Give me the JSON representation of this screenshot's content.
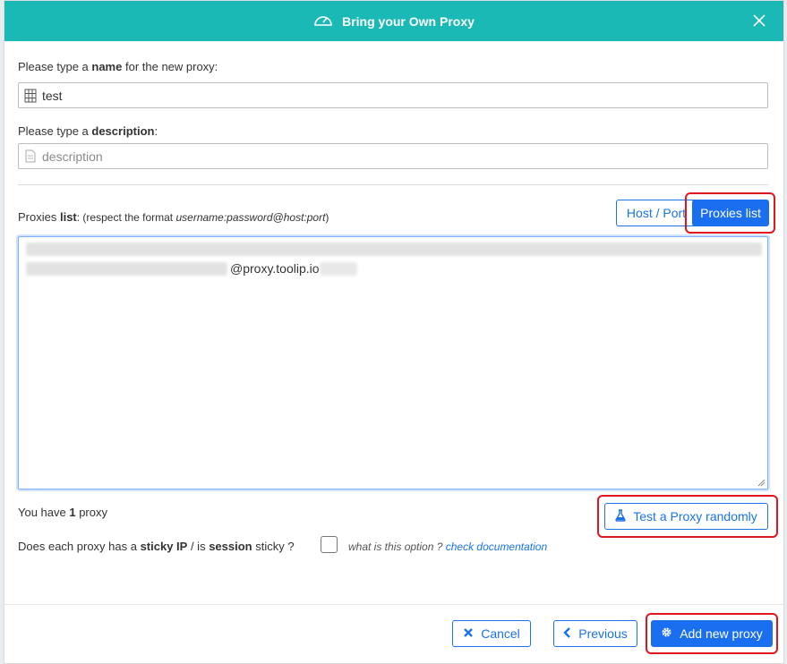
{
  "modal": {
    "title": "Bring your Own Proxy",
    "title_icon": "gauge-icon",
    "close_icon": "close-icon"
  },
  "name_field": {
    "label_prefix": "Please type a ",
    "label_bold": "name",
    "label_suffix": " for the new proxy:",
    "value": "test",
    "icon": "server-icon"
  },
  "description_field": {
    "label_prefix": "Please type a ",
    "label_bold": "description",
    "label_suffix": ":",
    "placeholder": "description",
    "icon": "document-icon"
  },
  "proxies": {
    "label_prefix": "Proxies ",
    "label_bold": "list",
    "label_suffix": ": (respect the format ",
    "format": "username:password@host:port",
    "label_close": ")",
    "toggle_host_port": "Host / Port",
    "toggle_proxies_list": "Proxies list",
    "visible_host": "@proxy.toolip.io"
  },
  "count": {
    "prefix": "You have ",
    "number": "1",
    "suffix": " proxy"
  },
  "test_button": {
    "label": "Test a Proxy randomly",
    "icon": "flask-icon"
  },
  "sticky": {
    "text_1": "Does each proxy has a ",
    "bold_1": "sticky IP",
    "text_2": " / is ",
    "bold_2": "session",
    "text_3": " sticky ?",
    "help_prefix": "what is this option ? ",
    "help_link": "check documentation",
    "checked": false
  },
  "footer": {
    "cancel_label": "Cancel",
    "cancel_icon": "times-icon",
    "previous_label": "Previous",
    "previous_icon": "chevron-left-icon",
    "add_label": "Add new proxy",
    "add_icon": "gear-icon"
  },
  "colors": {
    "header": "#1ab9b5",
    "primary": "#1a6ff0",
    "highlight": "#e0151d"
  }
}
